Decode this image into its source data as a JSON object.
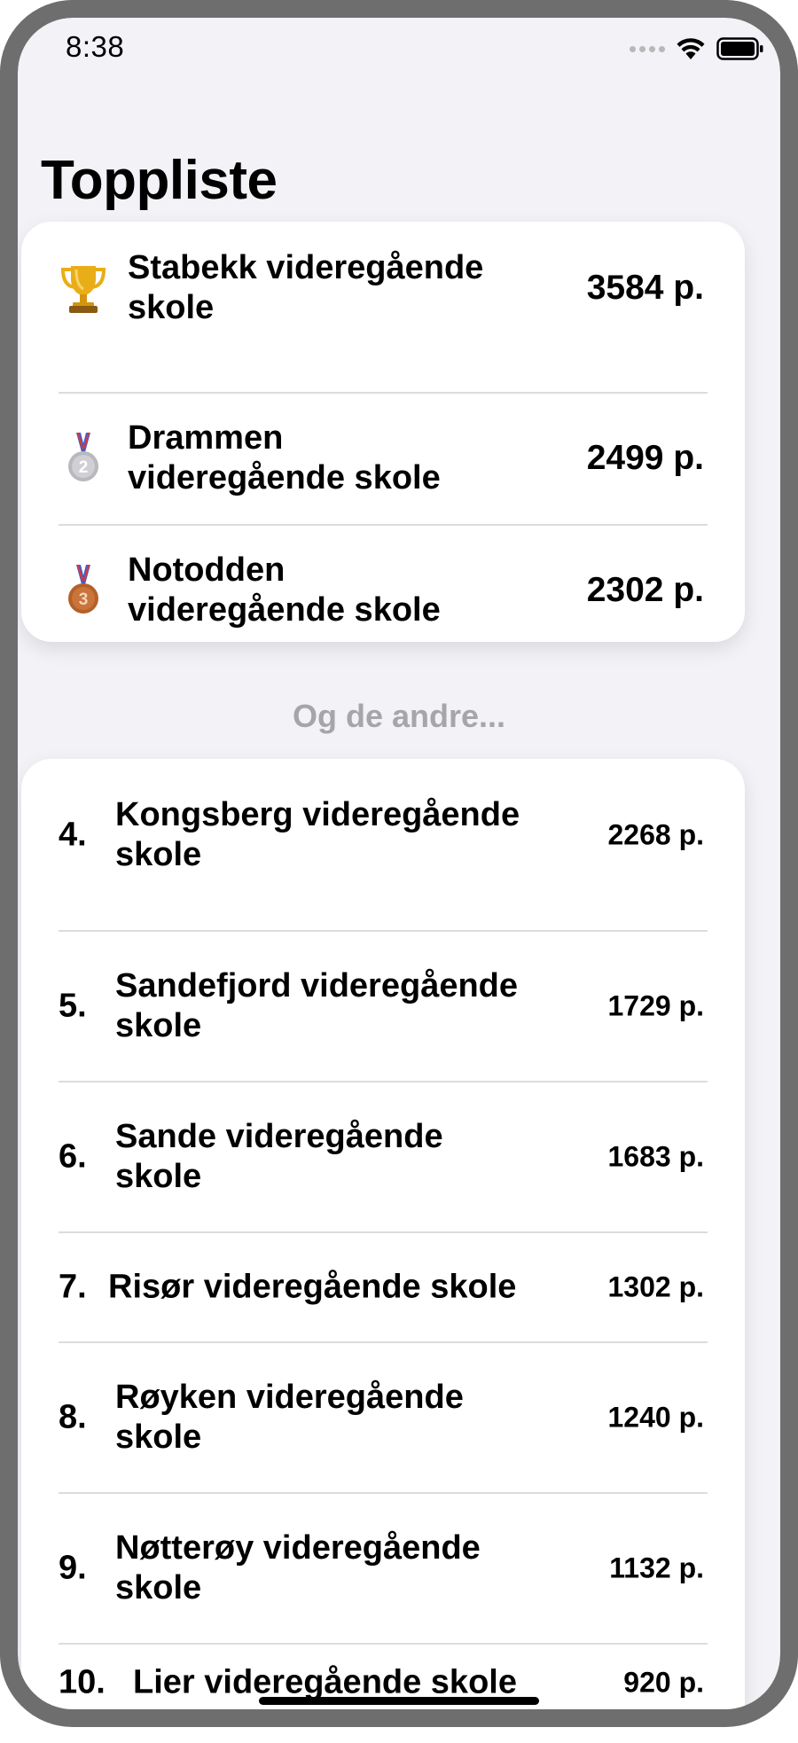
{
  "status_bar": {
    "time": "8:38",
    "icons": [
      "signal-dots-icon",
      "wifi-icon",
      "battery-icon"
    ]
  },
  "page": {
    "title": "Toppliste"
  },
  "top_three": [
    {
      "medal": "trophy-icon",
      "name_lines": [
        "Stabekk videregående",
        "skole"
      ],
      "points": "3584 p."
    },
    {
      "medal": "silver-medal-icon",
      "medal_number": "2",
      "name_lines": [
        "Drammen",
        "videregående skole"
      ],
      "points": "2499 p."
    },
    {
      "medal": "bronze-medal-icon",
      "medal_number": "3",
      "name_lines": [
        "Notodden",
        "videregående skole"
      ],
      "points": "2302 p."
    }
  ],
  "section_label": "Og de andre...",
  "others": [
    {
      "rank": "4.",
      "name_lines": [
        "Kongsberg videregående",
        "skole"
      ],
      "points": "2268 p."
    },
    {
      "rank": "5.",
      "name_lines": [
        "Sandefjord videregående",
        "skole"
      ],
      "points": "1729 p."
    },
    {
      "rank": "6.",
      "name_lines": [
        "Sande videregående",
        "skole"
      ],
      "points": "1683 p."
    },
    {
      "rank": "7.",
      "name_lines": [
        "Risør videregående skole",
        ""
      ],
      "points": "1302 p."
    },
    {
      "rank": "8.",
      "name_lines": [
        "Røyken videregående",
        "skole"
      ],
      "points": "1240 p."
    },
    {
      "rank": "9.",
      "name_lines": [
        "Nøtterøy videregående",
        "skole"
      ],
      "points": "1132 p."
    },
    {
      "rank": "10.",
      "name_lines": [
        "Lier videregående skole",
        ""
      ],
      "points": "920 p."
    }
  ],
  "colors": {
    "background": "#f2f2f7",
    "card": "#ffffff",
    "text": "#000000",
    "muted": "#a6a6aa",
    "gold": "#e0a412",
    "silver": "#b8b8be",
    "bronze": "#b5602a",
    "frame": "#6e6e6e"
  }
}
